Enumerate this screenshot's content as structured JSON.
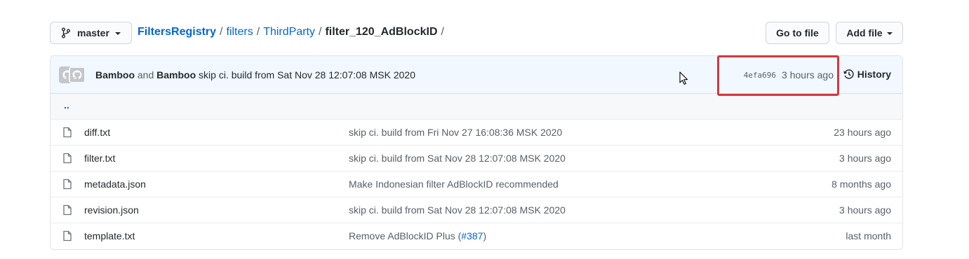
{
  "branch": {
    "name": "master"
  },
  "breadcrumb": {
    "repo": "FiltersRegistry",
    "parts": [
      "filters",
      "ThirdParty"
    ],
    "current": "filter_120_AdBlockID",
    "sep": "/"
  },
  "actions": {
    "goto_file": "Go to file",
    "add_file": "Add file"
  },
  "commit": {
    "author1": "Bamboo",
    "and": "and",
    "author2": "Bamboo",
    "message": "skip ci. build from Sat Nov 28 12:07:08 MSK 2020",
    "sha": "4efa696",
    "time": "3 hours ago",
    "history_label": "History"
  },
  "parent_dir": "..",
  "files": [
    {
      "name": "diff.txt",
      "message": "skip ci. build from Fri Nov 27 16:08:36 MSK 2020",
      "message_link": "",
      "message_tail": "",
      "age": "23 hours ago"
    },
    {
      "name": "filter.txt",
      "message": "skip ci. build from Sat Nov 28 12:07:08 MSK 2020",
      "message_link": "",
      "message_tail": "",
      "age": "3 hours ago"
    },
    {
      "name": "metadata.json",
      "message": "Make Indonesian filter AdBlockID recommended",
      "message_link": "",
      "message_tail": "",
      "age": "8 months ago"
    },
    {
      "name": "revision.json",
      "message": "skip ci. build from Sat Nov 28 12:07:08 MSK 2020",
      "message_link": "",
      "message_tail": "",
      "age": "3 hours ago"
    },
    {
      "name": "template.txt",
      "message": "Remove AdBlockID Plus (",
      "message_link": "#387",
      "message_tail": ")",
      "age": "last month"
    }
  ],
  "icons": {
    "branch": "git-branch-icon",
    "file": "file-icon",
    "history": "history-clock-icon",
    "avatar": "github-avatar-icon",
    "cursor": "mouse-cursor-icon"
  },
  "colors": {
    "link": "#0366d6",
    "commit_bg": "#f1f8ff",
    "highlight_box": "#d9363e",
    "muted": "#586069"
  }
}
